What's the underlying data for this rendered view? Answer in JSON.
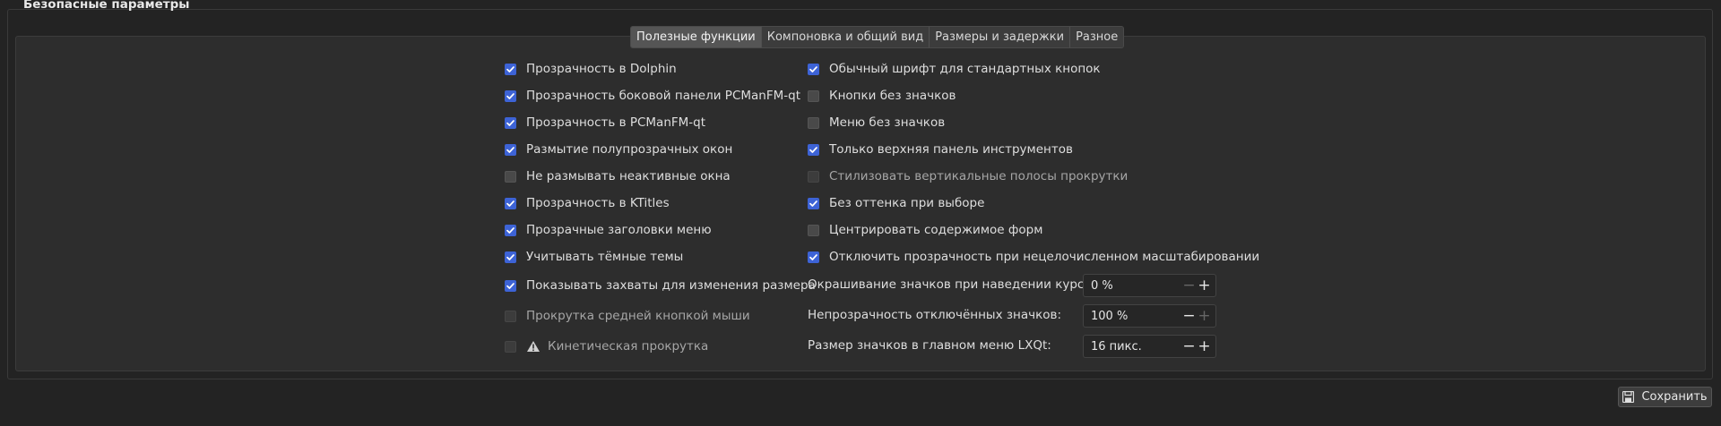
{
  "group": {
    "title": "Безопасные параметры"
  },
  "tabs": [
    {
      "label": "Полезные функции",
      "active": true
    },
    {
      "label": "Компоновка и общий вид",
      "active": false
    },
    {
      "label": "Размеры и задержки",
      "active": false
    },
    {
      "label": "Разное",
      "active": false
    }
  ],
  "left_options": [
    {
      "label": "Прозрачность в Dolphin",
      "checked": true,
      "enabled": true
    },
    {
      "label": "Прозрачность боковой панели PCManFM-qt",
      "checked": true,
      "enabled": true
    },
    {
      "label": "Прозрачность в PCManFM-qt",
      "checked": true,
      "enabled": true
    },
    {
      "label": "Размытие полупрозрачных окон",
      "checked": true,
      "enabled": true
    },
    {
      "label": "Не размывать неактивные окна",
      "checked": false,
      "enabled": true
    },
    {
      "label": "Прозрачность в KTitles",
      "checked": true,
      "enabled": true
    },
    {
      "label": "Прозрачные заголовки меню",
      "checked": true,
      "enabled": true
    },
    {
      "label": "Учитывать тёмные темы",
      "checked": true,
      "enabled": true
    },
    {
      "label": "Показывать захваты для изменения размера",
      "checked": true,
      "enabled": true
    },
    {
      "label": "Прокрутка средней кнопкой мыши",
      "checked": false,
      "enabled": false
    },
    {
      "label": "Кинетическая прокрутка",
      "checked": false,
      "enabled": false,
      "icon": "warning-icon"
    }
  ],
  "right_options": [
    {
      "label": "Обычный шрифт для стандартных кнопок",
      "checked": true,
      "enabled": true
    },
    {
      "label": "Кнопки без значков",
      "checked": false,
      "enabled": true
    },
    {
      "label": "Меню без значков",
      "checked": false,
      "enabled": true
    },
    {
      "label": "Только верхняя панель инструментов",
      "checked": true,
      "enabled": true
    },
    {
      "label": "Стилизовать вертикальные полосы прокрутки",
      "checked": false,
      "enabled": false
    },
    {
      "label": "Без оттенка при выборе",
      "checked": true,
      "enabled": true
    },
    {
      "label": "Центрировать содержимое форм",
      "checked": false,
      "enabled": true
    },
    {
      "label": "Отключить прозрачность при нецелочисленном масштабировании",
      "checked": true,
      "enabled": true
    }
  ],
  "spinboxes": [
    {
      "label": "Окрашивание значков при наведении курсора:",
      "value": "0 %",
      "minus_enabled": false,
      "plus_enabled": true
    },
    {
      "label": "Непрозрачность отключённых значков:",
      "value": "100 %",
      "minus_enabled": true,
      "plus_enabled": false
    },
    {
      "label": "Размер значков в главном меню LXQt:",
      "value": "16 пикс.",
      "minus_enabled": true,
      "plus_enabled": true
    }
  ],
  "save_button": {
    "label": "Сохранить",
    "icon": "save-icon"
  },
  "colors": {
    "accent": "#3d63d6",
    "background": "#232323",
    "panel": "#2d2d2d"
  }
}
